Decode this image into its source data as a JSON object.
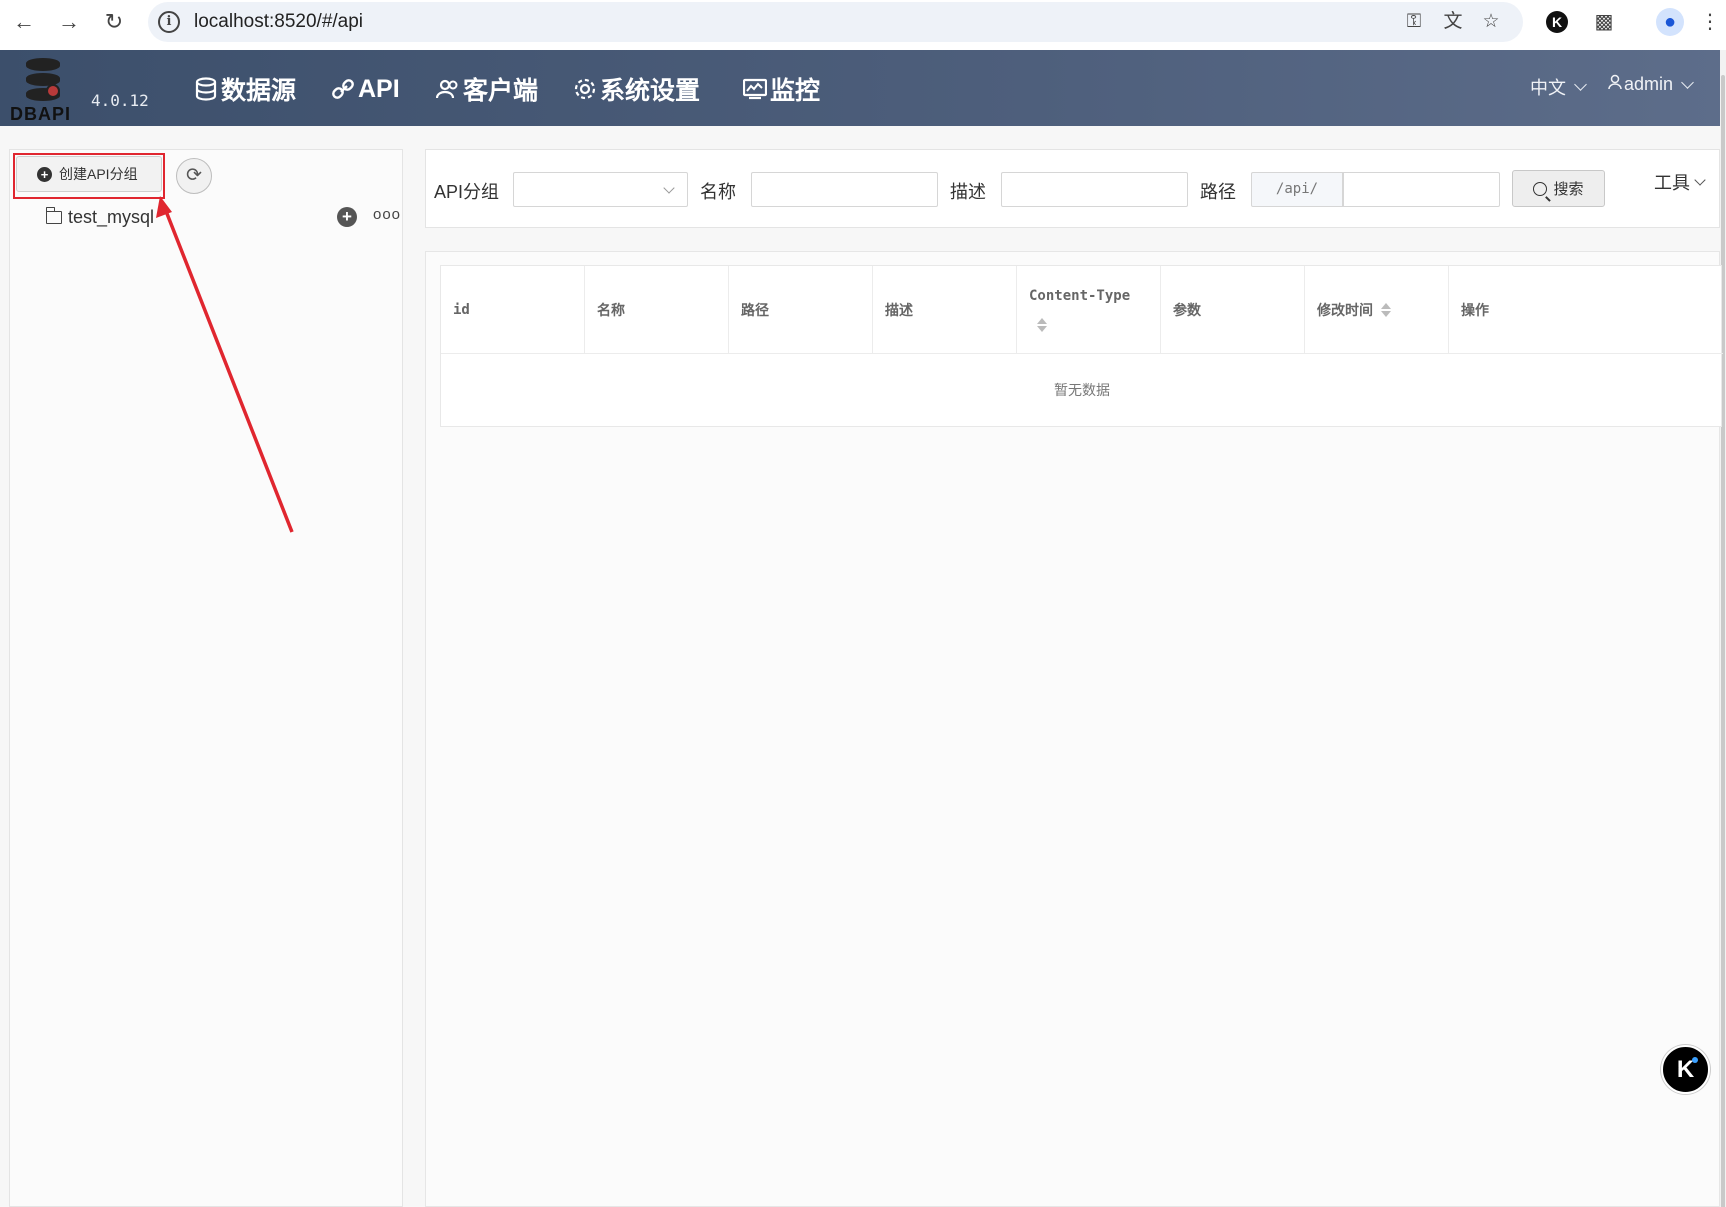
{
  "browser": {
    "url": "localhost:8520/#/api",
    "ext_badge": "K"
  },
  "app": {
    "brand": "DBAPI",
    "version": "4.0.12",
    "nav": [
      {
        "label": "数据源",
        "icon": "database-icon"
      },
      {
        "label": "API",
        "icon": "link-icon"
      },
      {
        "label": "客户端",
        "icon": "users-icon"
      },
      {
        "label": "系统设置",
        "icon": "gear-icon"
      },
      {
        "label": "监控",
        "icon": "monitor-icon"
      }
    ],
    "language": "中文",
    "user": "admin"
  },
  "sidebar": {
    "create_group_label": "创建API分组",
    "tree": [
      {
        "label": "test_mysql"
      }
    ],
    "more_label": "ooo"
  },
  "search": {
    "group_label": "API分组",
    "group_value": "",
    "name_label": "名称",
    "name_value": "",
    "desc_label": "描述",
    "desc_value": "",
    "path_label": "路径",
    "path_prefix": "/api/",
    "path_value": "",
    "search_button": "搜索",
    "tools_label": "工具"
  },
  "table": {
    "columns": [
      "id",
      "名称",
      "路径",
      "描述",
      "Content-Type",
      "参数",
      "修改时间",
      "操作"
    ],
    "sortable": [
      "Content-Type",
      "修改时间"
    ],
    "rows": [],
    "empty_text": "暂无数据"
  },
  "colors": {
    "header_bg": "#3c4f6b",
    "annotation_red": "#e0262f",
    "floating_badge_dot": "#3aa0ff"
  }
}
